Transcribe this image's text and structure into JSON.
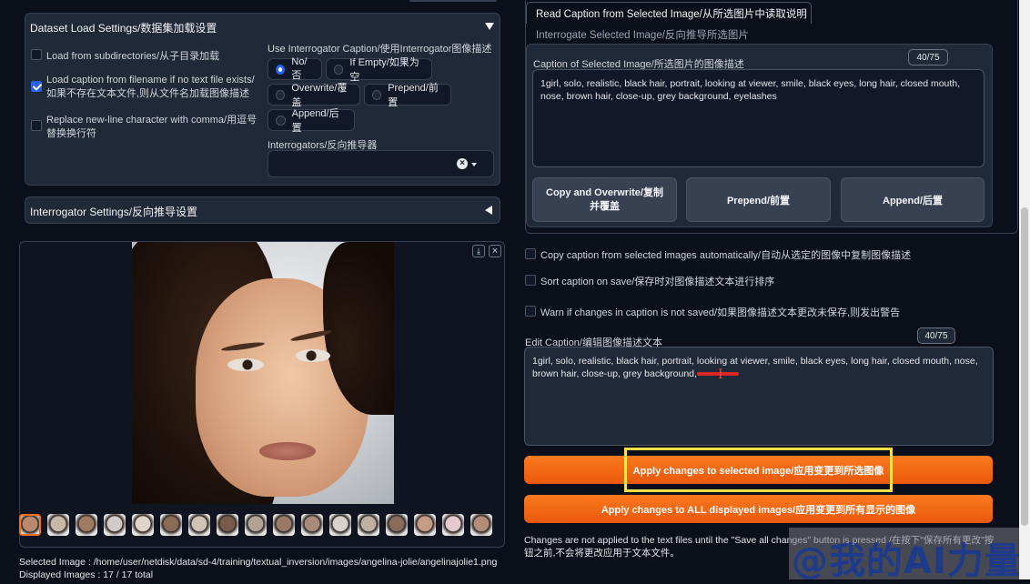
{
  "left": {
    "dataset_load": {
      "title": "Dataset Load Settings/数据集加载设置",
      "opt1": "Load from subdirectories/从子目录加载",
      "opt2": "Load caption from filename if no text file exists/如果不存在文本文件,则从文件名加载图像描述",
      "opt3": "Replace new-line character with comma/用逗号替换换行符",
      "use_caption_label": "Use Interrogator Caption/使用Interrogator图像描述",
      "radio_no": "No/否",
      "radio_ifempty": "If Empty/如果为空",
      "radio_overwrite": "Overwrite/覆盖",
      "radio_prepend": "Prepend/前置",
      "radio_append": "Append/后置",
      "interrogators_label": "Interrogators/反向推导器"
    },
    "interrogator_settings": {
      "title": "Interrogator Settings/反向推导设置"
    },
    "status": {
      "selected_image": "Selected Image : /home/user/netdisk/data/sd-4/training/textual_inversion/images/angelina-jolie/angelinajolie1.png",
      "displayed_images": "Displayed Images : 17 / 17 total"
    }
  },
  "right": {
    "tabs": {
      "read_caption": "Read Caption from Selected Image/从所选图片中读取说明",
      "interrogate": "Interrogate Selected Image/反向推导所选图片"
    },
    "caption_of_selected": {
      "label": "Caption of Selected Image/所选图片的图像描述",
      "count": "40/75",
      "value": "1girl, solo, realistic, black hair, portrait, looking at viewer, smile, black eyes, long hair, closed mouth, nose, brown hair, close-up, grey background, eyelashes"
    },
    "buttons": {
      "copy_overwrite": "Copy and Overwrite/复制并覆盖",
      "prepend": "Prepend/前置",
      "append": "Append/后置"
    },
    "options": {
      "copy_auto": "Copy caption from selected images automatically/自动从选定的图像中复制图像描述",
      "sort_on_save": "Sort caption on save/保存时对图像描述文本进行排序",
      "warn_changes": "Warn if changes in caption is not saved/如果图像描述文本更改未保存,则发出警告"
    },
    "edit_caption": {
      "label": "Edit Caption/编辑图像描述文本",
      "count": "40/75",
      "value": "1girl, solo, realistic, black hair, portrait, looking at viewer, smile, black eyes, long hair, closed mouth, nose, brown hair, close-up, grey background,"
    },
    "apply_selected": "Apply changes to selected image/应用变更到所选图像",
    "apply_all": "Apply changes to ALL displayed images/应用变更到所有显示的图像",
    "note": "Changes are not applied to the text files until the \"Save all changes\" button is pressed./在按下\"保存所有更改\"按钮之前,不会将更改应用于文本文件。"
  },
  "watermark": "@我的AI力量",
  "colors": {
    "background": "#0b0f19",
    "panel": "#1f2937",
    "accent_orange": "#f97316",
    "checkbox_blue": "#2563eb",
    "highlight_yellow": "#fde047",
    "red_scribble": "#dc2626"
  },
  "icons": {
    "collapse_open": "triangle-down-icon",
    "collapse_closed": "triangle-left-icon",
    "download": "download-icon",
    "close": "close-icon",
    "clear": "clear-x-icon",
    "dropdown": "caret-down-icon",
    "text_cursor": "i-beam-cursor-icon"
  }
}
